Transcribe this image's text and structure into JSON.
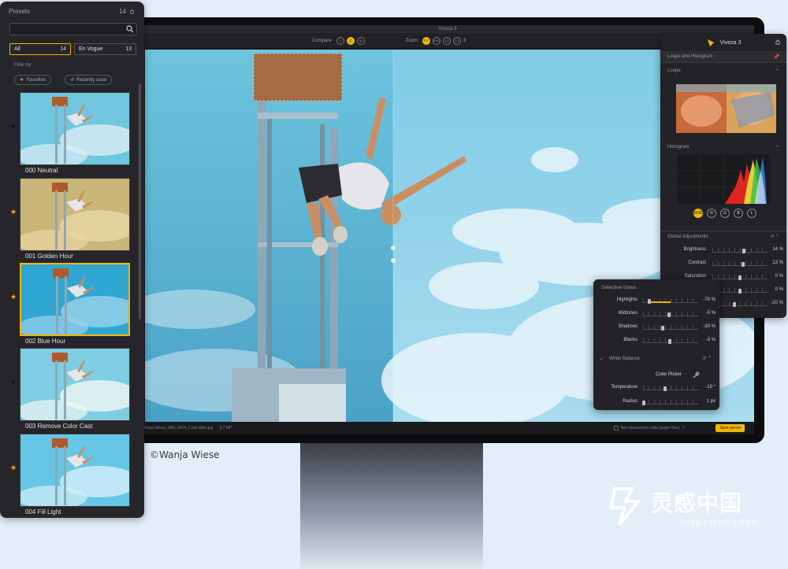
{
  "app": {
    "window_title": "Viveza 3",
    "brand": "Viveza 3",
    "accent": "#f2b705"
  },
  "toolbar": {
    "compare_label": "Compare",
    "zoom_label": "Zoom",
    "zoom_fit": "FIT",
    "zoom_fill": "FILL",
    "zoom_1_1": "1:1",
    "zoom_2_1": "2:1",
    "zoom_extra": "3"
  },
  "status": {
    "filename": "Wanja Wiese_IMG_0434_Color Efex.jpg",
    "megapixels": "6.7 MP",
    "non_destructive": "Non-destructive edits (larger files)",
    "save_label": "Save preset"
  },
  "credit": "©Wanja Wiese",
  "presets": {
    "title": "Presets",
    "count": "14",
    "search_placeholder": "",
    "tabs": [
      {
        "label": "All",
        "count": "14",
        "active": true
      },
      {
        "label": "En Vogue",
        "count": "13",
        "active": false
      }
    ],
    "filter_label": "Filter by:",
    "chips": [
      {
        "label": "Favorites",
        "icon": "star-icon"
      },
      {
        "label": "Recently used",
        "icon": "history-icon"
      }
    ],
    "items": [
      {
        "name": "000 Neutral",
        "star": "black",
        "tone": "neutral"
      },
      {
        "name": "001 Golden Hour",
        "star": "gold",
        "tone": "golden"
      },
      {
        "name": "002 Blue Hour",
        "star": "gold",
        "tone": "blue",
        "selected": true
      },
      {
        "name": "003 Remove Color Cast",
        "star": "black",
        "tone": "clean"
      },
      {
        "name": "004 Fill Light",
        "star": "gold",
        "tone": "bright"
      }
    ]
  },
  "right_panel": {
    "loupe_histogram_label": "Loupe and Histogram",
    "loupe_label": "Loupe",
    "histogram_label": "Histogram",
    "channels": [
      "RGB",
      "R",
      "G",
      "B",
      "L"
    ],
    "global_label": "Global Adjustments",
    "adjustments": [
      {
        "label": "Brightness",
        "value": "14",
        "unit": "%",
        "pos": 0.57
      },
      {
        "label": "Contrast",
        "value": "13",
        "unit": "%",
        "pos": 0.56
      },
      {
        "label": "Saturation",
        "value": "0",
        "unit": "%",
        "pos": 0.5
      },
      {
        "label": "",
        "value": "0",
        "unit": "%",
        "pos": 0.5
      },
      {
        "label": "",
        "value": "-20",
        "unit": "%",
        "pos": 0.4
      }
    ]
  },
  "selective_tones": {
    "title": "Selective tones",
    "rows": [
      {
        "label": "Highlights",
        "value": "-78",
        "unit": "%",
        "pos": 0.11
      },
      {
        "label": "Midtones",
        "value": "-5",
        "unit": "%",
        "pos": 0.47
      },
      {
        "label": "Shadows",
        "value": "-30",
        "unit": "%",
        "pos": 0.35
      },
      {
        "label": "Blacks",
        "value": "-3",
        "unit": "%",
        "pos": 0.48
      }
    ],
    "white_balance_label": "White Balance",
    "color_picker_label": "Color Picker",
    "wb_rows": [
      {
        "label": "Temperature",
        "value": "-19",
        "unit": "°",
        "pos": 0.4
      },
      {
        "label": "Radius",
        "value": "1",
        "unit": "px",
        "pos": 0.02
      }
    ]
  },
  "watermark": {
    "chinese": "灵感中国",
    "english": "lingganchina.com"
  }
}
